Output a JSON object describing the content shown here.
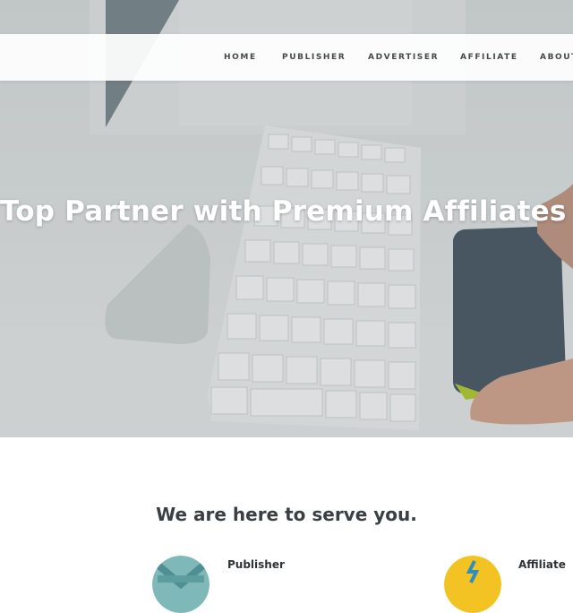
{
  "nav": {
    "items": [
      {
        "label": "HOME"
      },
      {
        "label": "PUBLISHER"
      },
      {
        "label": "ADVERTISER"
      },
      {
        "label": "AFFILIATE"
      },
      {
        "label": "ABOUT"
      }
    ]
  },
  "hero": {
    "title": "Top Partner with Premium Affiliates"
  },
  "serve": {
    "heading": "We are here to serve you.",
    "services": [
      {
        "label": "Publisher",
        "icon": "publisher-icon",
        "color": "#7fb8b8"
      },
      {
        "label": "Affiliate",
        "icon": "affiliate-icon",
        "color": "#f2c322"
      }
    ]
  },
  "colors": {
    "hero_text": "#ffffff",
    "nav_text": "#444a4c",
    "heading_text": "#3a3f42",
    "trackpad_accent": "#b6d12c"
  }
}
